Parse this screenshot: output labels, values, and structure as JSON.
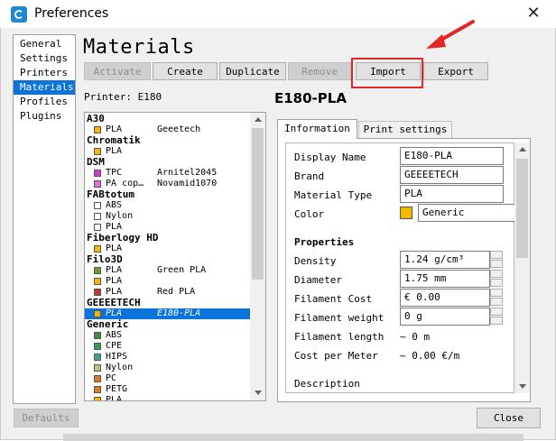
{
  "window": {
    "title": "Preferences",
    "close_glyph": "✕"
  },
  "nav": {
    "items": [
      {
        "label": "General",
        "selected": false
      },
      {
        "label": "Settings",
        "selected": false
      },
      {
        "label": "Printers",
        "selected": false
      },
      {
        "label": "Materials",
        "selected": true
      },
      {
        "label": "Profiles",
        "selected": false
      },
      {
        "label": "Plugins",
        "selected": false
      }
    ]
  },
  "page": {
    "title": "Materials",
    "printer_label": "Printer: E180"
  },
  "toolbar": {
    "activate": "Activate",
    "create": "Create",
    "duplicate": "Duplicate",
    "remove": "Remove",
    "import": "Import",
    "export": "Export"
  },
  "materials": [
    {
      "brand": "A30",
      "items": [
        {
          "type": "PLA",
          "name": "Geeetech",
          "color": "#f5b800"
        }
      ]
    },
    {
      "brand": "Chromatik",
      "items": [
        {
          "type": "PLA",
          "name": "",
          "color": "#f5b800"
        }
      ]
    },
    {
      "brand": "DSM",
      "items": [
        {
          "type": "TPC",
          "name": "Arnitel2045",
          "color": "#d63ad6"
        },
        {
          "type": "PA cop…",
          "name": "Novamid1070",
          "color": "#e06ce0"
        }
      ]
    },
    {
      "brand": "FABtotum",
      "items": [
        {
          "type": "ABS",
          "name": "",
          "color": "#ffffff"
        },
        {
          "type": "Nylon",
          "name": "",
          "color": "#ffffff"
        },
        {
          "type": "PLA",
          "name": "",
          "color": "#ffffff"
        }
      ]
    },
    {
      "brand": "Fiberlogy HD",
      "items": [
        {
          "type": "PLA",
          "name": "",
          "color": "#f5b800"
        }
      ]
    },
    {
      "brand": "Filo3D",
      "items": [
        {
          "type": "PLA",
          "name": "Green PLA",
          "color": "#6a9e3a"
        },
        {
          "type": "PLA",
          "name": "",
          "color": "#f5b800"
        },
        {
          "type": "PLA",
          "name": "Red PLA",
          "color": "#c0392b"
        }
      ]
    },
    {
      "brand": "GEEEETECH",
      "items": [
        {
          "type": "PLA",
          "name": "E180-PLA",
          "color": "#f5b800",
          "selected": true
        }
      ]
    },
    {
      "brand": "Generic",
      "items": [
        {
          "type": "ABS",
          "name": "",
          "color": "#3f8a3f"
        },
        {
          "type": "CPE",
          "name": "",
          "color": "#2f9e5f"
        },
        {
          "type": "HIPS",
          "name": "",
          "color": "#3aa0a0"
        },
        {
          "type": "Nylon",
          "name": "",
          "color": "#b5c77a"
        },
        {
          "type": "PC",
          "name": "",
          "color": "#e07a1f"
        },
        {
          "type": "PETG",
          "name": "",
          "color": "#e07a1f"
        },
        {
          "type": "PLA",
          "name": "",
          "color": "#f5b800"
        }
      ]
    }
  ],
  "detail": {
    "title": "E180-PLA",
    "tabs": {
      "information": "Information",
      "print_settings": "Print settings"
    },
    "fields": {
      "display_name_label": "Display Name",
      "display_name": "E180-PLA",
      "brand_label": "Brand",
      "brand": "GEEEETECH",
      "material_type_label": "Material Type",
      "material_type": "PLA",
      "color_label": "Color",
      "color_name": "Generic",
      "color_hex": "#f5b800",
      "properties_heading": "Properties",
      "density_label": "Density",
      "density": "1.24 g/cm³",
      "diameter_label": "Diameter",
      "diameter": "1.75 mm",
      "filament_cost_label": "Filament Cost",
      "filament_cost": "€ 0.00",
      "filament_weight_label": "Filament weight",
      "filament_weight": "0 g",
      "filament_length_label": "Filament length",
      "filament_length": "~ 0 m",
      "cost_per_meter_label": "Cost per Meter",
      "cost_per_meter": "~ 0.00 €/m",
      "description_label": "Description"
    }
  },
  "footer": {
    "defaults": "Defaults",
    "close": "Close"
  },
  "annotation": {
    "arrow_color": "#e32626"
  }
}
